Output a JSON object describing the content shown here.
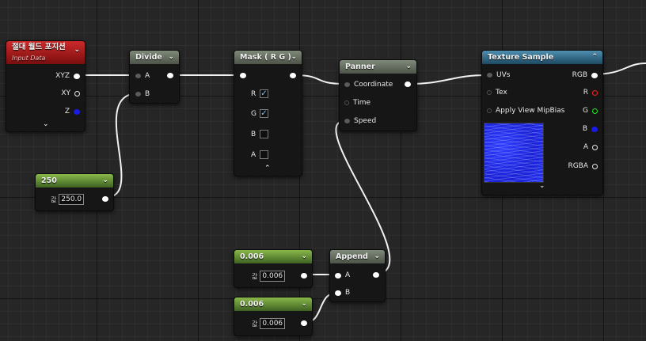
{
  "nodes": {
    "world_position": {
      "title": "절대 월드 포지션",
      "subtitle": "Input Data",
      "pins": {
        "xyz": "XYZ",
        "xy": "XY",
        "z": "Z"
      }
    },
    "divide": {
      "title": "Divide",
      "pins": {
        "a": "A",
        "b": "B"
      }
    },
    "mask": {
      "title": "Mask ( R G )",
      "channels": {
        "r": "R",
        "g": "G",
        "b": "B",
        "a": "A"
      },
      "checked": {
        "r": true,
        "g": true,
        "b": false,
        "a": false
      }
    },
    "panner": {
      "title": "Panner",
      "pins": {
        "coordinate": "Coordinate",
        "time": "Time",
        "speed": "Speed"
      }
    },
    "texture_sample": {
      "title": "Texture Sample",
      "inputs": {
        "uvs": "UVs",
        "tex": "Tex",
        "mip": "Apply View MipBias"
      },
      "outputs": {
        "rgb": "RGB",
        "r": "R",
        "g": "G",
        "b": "B",
        "a": "A",
        "rgba": "RGBA"
      }
    },
    "const_250": {
      "title": "250",
      "label": "값",
      "value": "250.0"
    },
    "const_a": {
      "title": "0.006",
      "label": "값",
      "value": "0.006"
    },
    "const_b": {
      "title": "0.006",
      "label": "값",
      "value": "0.006"
    },
    "append": {
      "title": "Append",
      "pins": {
        "a": "A",
        "b": "B"
      }
    }
  },
  "icons": {
    "collapse": "chevron-down-icon",
    "expand": "chevron-up-icon",
    "check": "checkmark-icon"
  },
  "colors": {
    "wire": "#ffffff",
    "red_pin": "#ff1e1e",
    "green_pin": "#1eea1e",
    "blue_pin": "#1a1ae6",
    "header_input": "#cc2a2a",
    "header_texture": "#4f8fb0",
    "header_const": "#8ab84a"
  }
}
